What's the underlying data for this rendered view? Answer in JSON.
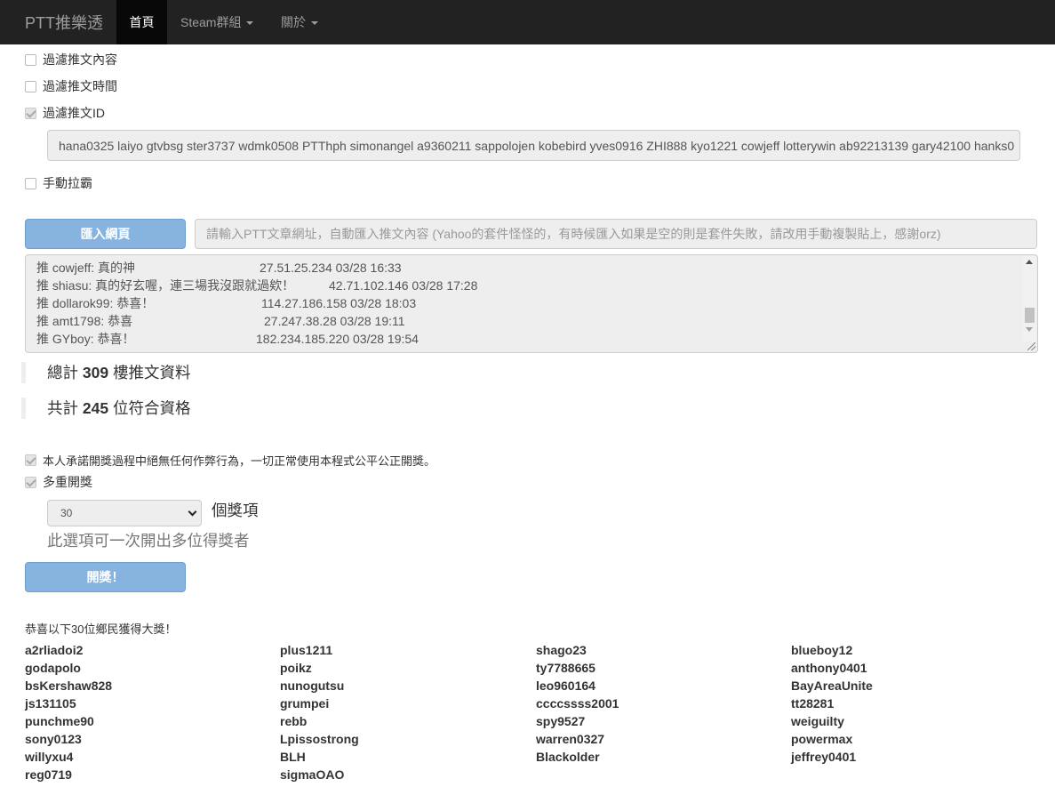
{
  "navbar": {
    "brand": "PTT推樂透",
    "items": [
      {
        "label": "首頁",
        "active": true,
        "dropdown": false
      },
      {
        "label": "Steam群組",
        "active": false,
        "dropdown": true
      },
      {
        "label": "關於",
        "active": false,
        "dropdown": true
      }
    ]
  },
  "filters": {
    "content": {
      "label": "過濾推文內容",
      "checked": false
    },
    "time": {
      "label": "過濾推文時間",
      "checked": false
    },
    "id": {
      "label": "過濾推文ID",
      "checked": true
    },
    "id_list": "hana0325 laiyo gtvbsg ster3737 wdmk0508 PTThph simonangel a9360211 sappolojen kobebird yves0916 ZHI888 kyo1221 cowjeff lotterywin ab92213139 gary42100 hanks0",
    "manual": {
      "label": "手動拉霸",
      "checked": false
    }
  },
  "import": {
    "button_label": "匯入網頁",
    "url_placeholder": "請輸入PTT文章網址，自動匯入推文內容 (Yahoo的套件怪怪的，有時候匯入如果是空的則是套件失敗，請改用手動複製貼上，感謝orz)"
  },
  "pushes": [
    {
      "text": "推 cowjeff: 真的神",
      "ip": "27.51.25.234 03/28 16:33"
    },
    {
      "text": "推 shiasu: 真的好玄喔，連三場我沒跟就過欸！",
      "ip": "42.71.102.146 03/28 17:28"
    },
    {
      "text": "推 dollarok99: 恭喜！",
      "ip": "114.27.186.158 03/28 18:03"
    },
    {
      "text": "推 amt1798: 恭喜",
      "ip": "27.247.38.28 03/28 19:11"
    },
    {
      "text": "推 GYboy: 恭喜！",
      "ip": "182.234.185.220 03/28 19:54"
    }
  ],
  "stats": {
    "total_prefix": "總計",
    "total_count": "309",
    "total_suffix": "樓推文資料",
    "qualified_prefix": "共計",
    "qualified_count": "245",
    "qualified_suffix": "位符合資格"
  },
  "options": {
    "pledge": {
      "label": "本人承諾開獎過程中絕無任何作弊行為，一切正常使用本程式公平公正開獎。",
      "checked": true
    },
    "multi": {
      "label": "多重開獎",
      "checked": true
    },
    "prize_count": "30",
    "prize_unit": "個獎項",
    "hint": "此選項可一次開出多位得獎者"
  },
  "draw_button": "開獎！",
  "congrats": "恭喜以下30位鄉民獲得大獎！",
  "winners": [
    "a2rliadoi2",
    "plus1211",
    "shago23",
    "blueboy12",
    "godapolo",
    "poikz",
    "ty7788665",
    "anthony0401",
    "bsKershaw828",
    "nunogutsu",
    "leo960164",
    "BayAreaUnite",
    "js131105",
    "grumpei",
    "ccccssss2001",
    "tt28281",
    "punchme90",
    "rebb",
    "spy9527",
    "weiguilty",
    "sony0123",
    "Lpissostrong",
    "warren0327",
    "powermax",
    "willyxu4",
    "BLH",
    "Blackolder",
    "jeffrey0401",
    "reg0719",
    "sigmaOAO"
  ]
}
